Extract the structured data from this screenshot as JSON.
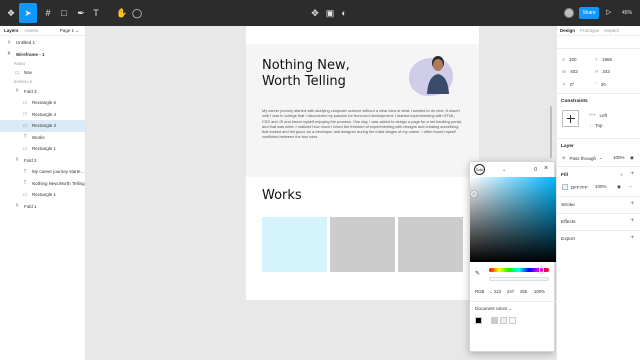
{
  "toolbar": {
    "share_label": "Share",
    "zoom": "45%",
    "tools": [
      {
        "icon": "figma-menu-icon",
        "glyph": "❖"
      },
      {
        "icon": "move-tool-icon",
        "glyph": "➤"
      },
      {
        "icon": "frame-tool-icon",
        "glyph": "#"
      },
      {
        "icon": "shape-tool-icon",
        "glyph": "□"
      },
      {
        "icon": "pen-tool-icon",
        "glyph": "✒"
      },
      {
        "icon": "text-tool-icon",
        "glyph": "T"
      },
      {
        "icon": "hand-tool-icon",
        "glyph": "✋"
      },
      {
        "icon": "comment-tool-icon",
        "glyph": "◯"
      },
      {
        "icon": "component-icon",
        "glyph": "✥"
      },
      {
        "icon": "mask-icon",
        "glyph": "▣"
      },
      {
        "icon": "contrast-icon",
        "glyph": "◐"
      }
    ]
  },
  "left_panel": {
    "tabs": [
      "Layers",
      "Assets"
    ],
    "page": "Page 1",
    "fixed_label": "FIXED",
    "scrolls_label": "SCROLLS",
    "layers": {
      "untitled": "Untitled 1",
      "wireframe": "Wireframe - 1",
      "nav": "Nav",
      "fold3": "Fold 3",
      "rect5": "Rectangle 5",
      "rect4": "Rectangle 4",
      "rect3": "Rectangle 3",
      "works": "Works",
      "rect1a": "Rectangle 1",
      "fold2": "Fold 2",
      "career": "My career journey starte...",
      "nothing": "Nothing New,Worth Telling",
      "rect1b": "Rectangle 1",
      "fold1": "Fold 1"
    }
  },
  "canvas": {
    "hero_title_line1": "Nothing New,",
    "hero_title_line2": "Worth Telling",
    "hero_body": "My career journey started with studying computer science without a clear idea of what I wanted to do next. It wasn't until I was in college that I discovered my passion for front-end development. I started experimenting with HTML, CSS and JS and found myself enjoying the process. One day, I was asked to design a page for a net banking portal, and that was when I realized how much I loved the freedom of experimenting with designs and creating something that looked and felt good. As a developer and designer during the initial stages of my career, I often found myself conflicted between the two roles.",
    "works_title": "Works",
    "card_colors": [
      "#d4f3fd",
      "#cccccc",
      "#cccccc"
    ],
    "help_label": "?"
  },
  "picker": {
    "mode_label": "Solid",
    "value_top": "0",
    "hex_mode": "RGB",
    "r": "223",
    "g": "247",
    "b": "255",
    "alpha": "100%",
    "doc_colors_label": "Document colors",
    "doc_colors": [
      "#000000",
      "#cccccc",
      "#eeeeee",
      "#f7f7f7"
    ]
  },
  "right_panel": {
    "tabs": [
      "Design",
      "Prototype",
      "Inspect"
    ],
    "x": "100",
    "y": "1986",
    "w": "402",
    "h": "343",
    "rotation": "0°",
    "radius": "20",
    "constraints_label": "Constraints",
    "constraint_h": "Left",
    "constraint_v": "Top",
    "layer_label": "Layer",
    "blend": "Pass through",
    "opacity": "100%",
    "fill_label": "Fill",
    "fill_hex": "DFF7FF",
    "fill_opacity": "100%",
    "stroke_label": "Stroke",
    "effects_label": "Effects",
    "export_label": "Export"
  }
}
